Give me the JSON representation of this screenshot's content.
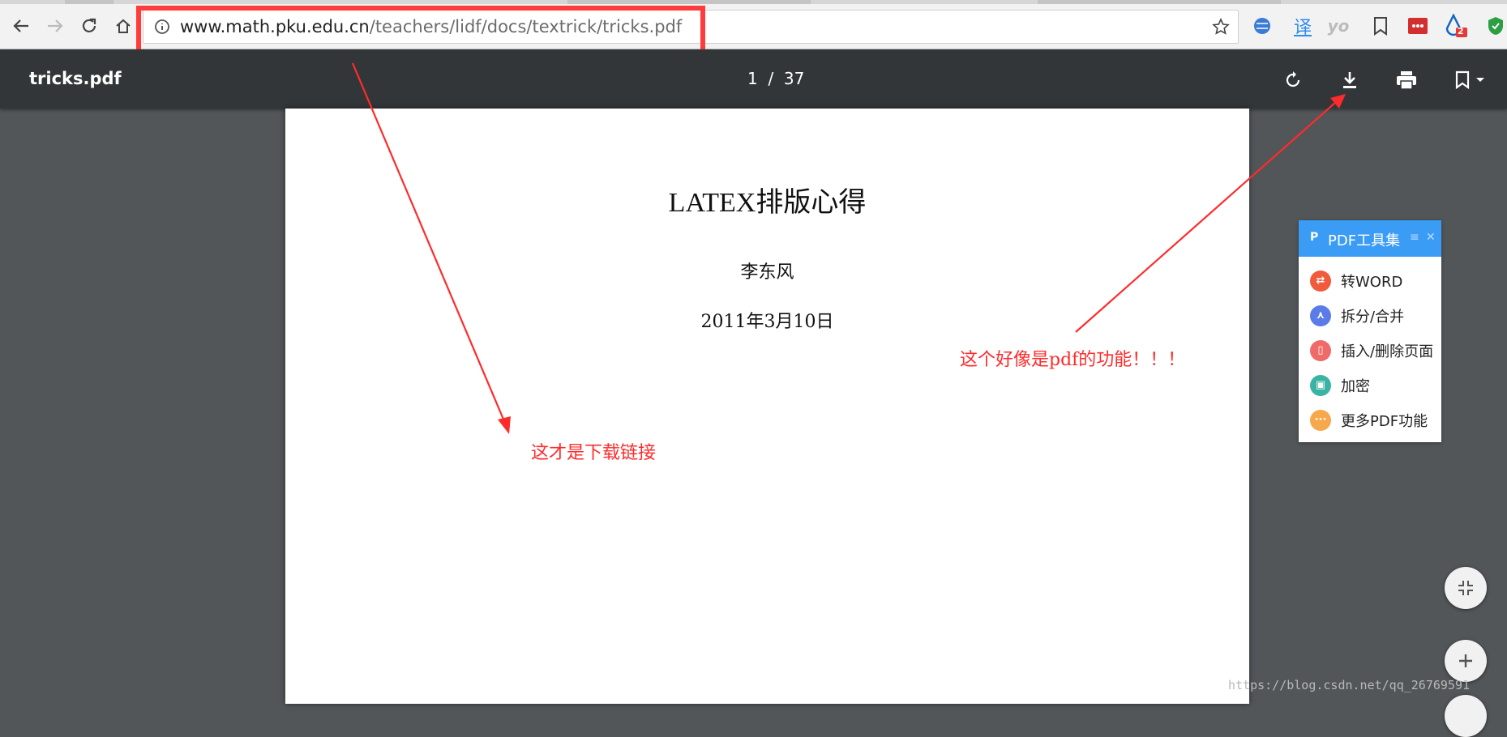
{
  "browser": {
    "url_host": "www.math.pku.edu.cn",
    "url_path": "/teachers/lidf/docs/textrick/tricks.pdf",
    "extensions": {
      "translate_label": "译",
      "yo_label": "yo",
      "badge_count": "2"
    }
  },
  "viewer": {
    "file_name": "tricks.pdf",
    "page_current": "1",
    "page_total": "37",
    "page_sep": "/"
  },
  "document": {
    "title_latex": "LATEX",
    "title_rest": "排版心得",
    "author": "李东风",
    "date": "2011年3月10日"
  },
  "annotations": {
    "download_note": "这才是下载链接",
    "pdf_note": "这个好像是pdf的功能！！！"
  },
  "tools_panel": {
    "logo": "P",
    "title": "PDF工具集",
    "items": [
      {
        "label": "转WORD",
        "color": "#f15a3a"
      },
      {
        "label": "拆分/合并",
        "color": "#5b7be8"
      },
      {
        "label": "插入/删除页面",
        "color": "#f06a6a"
      },
      {
        "label": "加密",
        "color": "#3bb3a4"
      },
      {
        "label": "更多PDF功能",
        "color": "#f7a84b"
      }
    ]
  },
  "watermark": "https://blog.csdn.net/qq_26769591",
  "colors": {
    "annotation_red": "#ff2b2b",
    "toolbar": "#323639",
    "viewer_bg": "#525659",
    "panel_header": "#3b9cf5"
  }
}
